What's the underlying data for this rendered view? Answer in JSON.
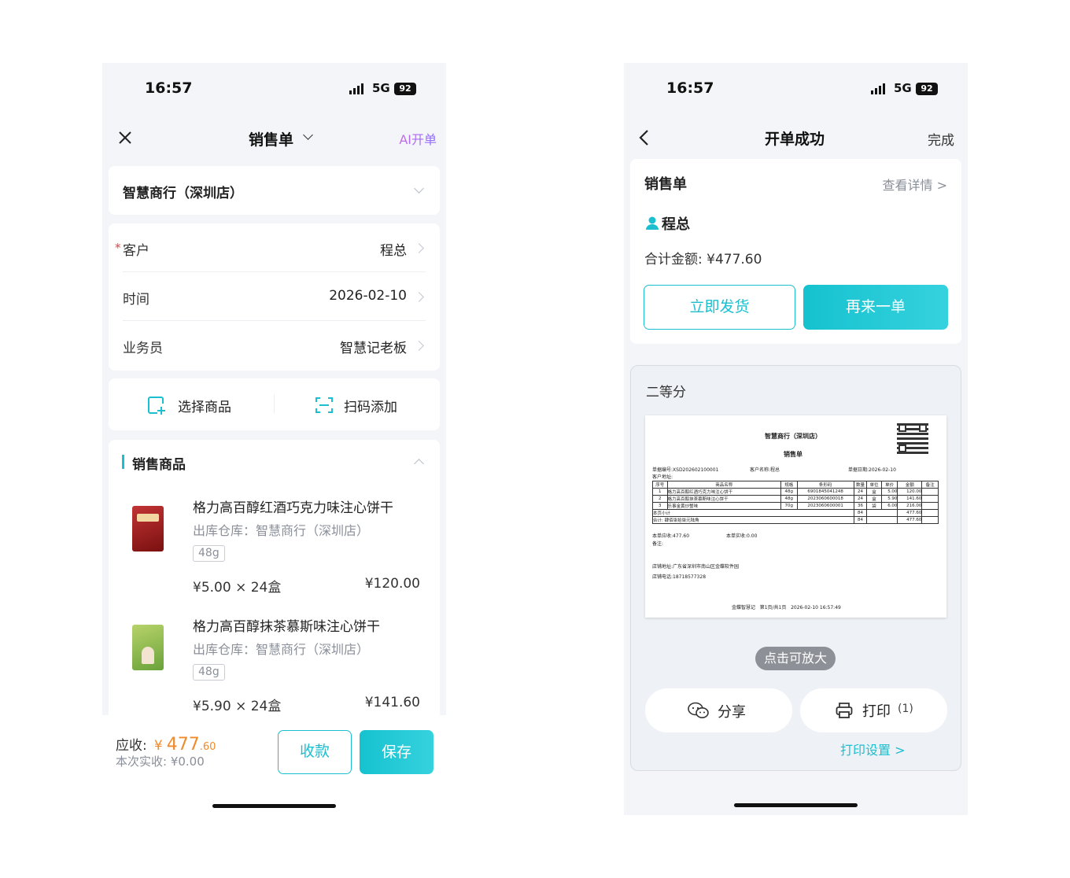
{
  "status": {
    "time": "16:57",
    "network": "5G",
    "battery": "92"
  },
  "left": {
    "nav": {
      "title": "销售单",
      "ai_label": "AI开单"
    },
    "store": "智慧商行（深圳店）",
    "fields": [
      {
        "label": "客户",
        "value": "程总",
        "required_mark": "*"
      },
      {
        "label": "时间",
        "value": "2026-02-10"
      },
      {
        "label": "业务员",
        "value": "智慧记老板"
      }
    ],
    "actions": {
      "select": "选择商品",
      "scan": "扫码添加"
    },
    "section_title": "销售商品",
    "products": [
      {
        "name": "格力高百醇红酒巧克力味注心饼干",
        "warehouse": "出库仓库：智慧商行（深圳店）",
        "spec": "48g",
        "qty": "¥5.00 × 24盒",
        "amount": "¥120.00"
      },
      {
        "name": "格力高百醇抹茶慕斯味注心饼干",
        "warehouse": "出库仓库：智慧商行（深圳店）",
        "spec": "48g",
        "qty": "¥5.90 × 24盒",
        "amount": "¥141.60"
      }
    ],
    "footer": {
      "due_label": "应收:",
      "currency": "¥",
      "due_int": "477",
      "due_dec": ".60",
      "paid": "本次实收: ¥0.00",
      "collect": "收款",
      "save": "保存"
    }
  },
  "right": {
    "nav": {
      "title": "开单成功",
      "done": "完成"
    },
    "order": {
      "title": "销售单",
      "detail": "查看详情 >",
      "customer": "程总",
      "total": "合计金额: ¥477.60",
      "ship": "立即发货",
      "again": "再来一单"
    },
    "preview": {
      "label": "二等分",
      "zoom": "点击可放大",
      "receipt": {
        "store": "智慧商行（深圳店）",
        "title": "销售单",
        "order_no": "单据编号:XSD202602100001",
        "customer": "客户名称:程总",
        "date": "单据日期:2026-02-10",
        "address": "客户地址:",
        "headers": [
          "序号",
          "商品名称",
          "规格",
          "条形码",
          "数量",
          "单位",
          "单价",
          "金额",
          "备注"
        ],
        "rows": [
          [
            "1",
            "格力高百醇红酒巧克力味注心饼干",
            "48g",
            "6901845041248",
            "24",
            "盒",
            "5.00",
            "120.00",
            ""
          ],
          [
            "2",
            "格力高百醇抹茶慕斯味注心饼干",
            "48g",
            "2023060600018",
            "24",
            "盒",
            "5.90",
            "141.60",
            ""
          ],
          [
            "3",
            "乐事金黄炒蟹味",
            "70g",
            "2023060600001",
            "36",
            "袋",
            "6.00",
            "216.00",
            ""
          ]
        ],
        "subtotal": {
          "label": "本页小计",
          "qty": "84",
          "amount": "477.60"
        },
        "total": {
          "label": "合计: 肆佰柒拾柒元陆角",
          "qty": "84",
          "amount": "477.60"
        },
        "due": "本单应收:477.60",
        "paid": "本单实收:0.00",
        "remark": "备注:",
        "shop_address": "店铺地址:广东省深圳市南山区金蝶软件园",
        "shop_phone": "店铺电话:18718577328",
        "footer": "金蝶智慧记   第1页/共1页   2026-02-10 16:57:49"
      }
    },
    "share": "分享",
    "print": "打印",
    "print_count": "(1)",
    "print_settings": "打印设置 >"
  }
}
